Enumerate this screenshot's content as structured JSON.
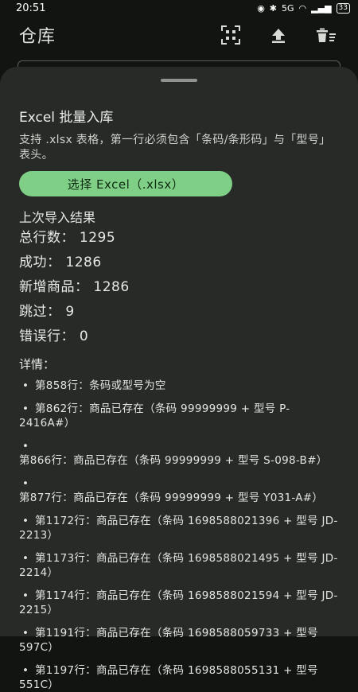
{
  "status": {
    "time": "20:51",
    "battery": "33",
    "network": "5G"
  },
  "app_bar": {
    "title": "仓库"
  },
  "sheet": {
    "title": "Excel 批量入库",
    "description": "支持 .xlsx 表格，第一行必须包含「条码/条形码」与「型号」表头。",
    "pick_button": "选择 Excel（.xlsx）",
    "result_title": "上次导入结果",
    "stats": [
      "总行数： 1295",
      "成功： 1286",
      "新增商品： 1286",
      "跳过： 9",
      "错误行： 0"
    ],
    "details_title": "详情：",
    "bullet": "•",
    "details": [
      "第858行：条码或型号为空",
      "第862行：商品已存在（条码 99999999 + 型号 P-2416A#）",
      "第866行：商品已存在（条码 99999999 + 型号 S-098-B#）",
      "第877行：商品已存在（条码 99999999 + 型号 Y031-A#）",
      "第1172行：商品已存在（条码 1698588021396 + 型号 JD-2213）",
      "第1173行：商品已存在（条码 1698588021495 + 型号 JD-2214）",
      "第1174行：商品已存在（条码 1698588021594 + 型号 JD-2215）",
      "第1191行：商品已存在（条码 1698588059733 + 型号 597C）",
      "第1197行：商品已存在（条码 1698588055131 + 型号 551C）"
    ]
  },
  "icons": {
    "scan": "qr-scan-icon",
    "upload": "upload-icon",
    "clear": "clear-all-icon"
  }
}
